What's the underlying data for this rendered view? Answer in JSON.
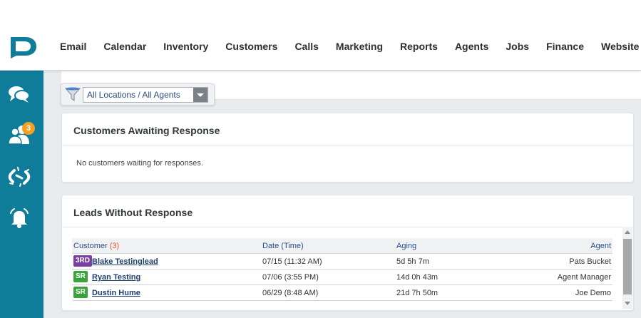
{
  "nav": {
    "items": [
      "Email",
      "Calendar",
      "Inventory",
      "Customers",
      "Calls",
      "Marketing",
      "Reports",
      "Agents",
      "Jobs",
      "Finance",
      "Website"
    ]
  },
  "sidebar": {
    "icons": [
      "chat-icon",
      "users-icon",
      "unlink-icon",
      "bell-icon"
    ],
    "badge": "3"
  },
  "filter": {
    "selected": "All Locations / All Agents"
  },
  "awaiting": {
    "title": "Customers Awaiting Response",
    "empty": "No customers waiting for responses."
  },
  "leads": {
    "title": "Leads Without Response",
    "columns": {
      "customer": "Customer",
      "count": "(3)",
      "date": "Date (Time)",
      "aging": "Aging",
      "agent": "Agent"
    },
    "rows": [
      {
        "tag": "3RD",
        "tag_color": "#7a3fa0",
        "customer": "Blake Testinglead",
        "date": "07/15 (11:32 AM)",
        "aging": "5d 5h 7m",
        "agent": "Pats Bucket"
      },
      {
        "tag": "SR",
        "tag_color": "#3aa23a",
        "customer": "Ryan Testing",
        "date": "07/06 (3:55 PM)",
        "aging": "14d 0h 43m",
        "agent": "Agent Manager"
      },
      {
        "tag": "SR",
        "tag_color": "#3aa23a",
        "customer": "Dustin Hume",
        "date": "06/29 (8:48 AM)",
        "aging": "21d 7h 50m",
        "agent": "Joe Demo"
      }
    ]
  },
  "colors": {
    "sidebar": "#0f7d99",
    "badge": "#f5a023",
    "link": "#1f3f6e",
    "header": "#2b4f8c"
  }
}
